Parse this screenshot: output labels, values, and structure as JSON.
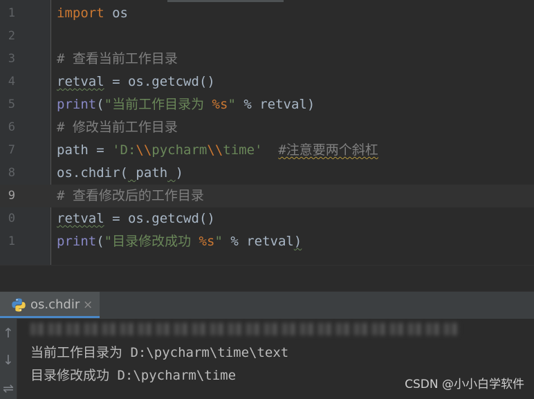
{
  "editor": {
    "line_numbers": [
      "1",
      "2",
      "3",
      "4",
      "5",
      "6",
      "7",
      "8",
      "9",
      "0",
      "1"
    ],
    "current_line_index": 8,
    "lines": [
      {
        "tokens": [
          {
            "t": "import",
            "c": "kw"
          },
          {
            "t": " os",
            "c": "op"
          }
        ]
      },
      {
        "tokens": []
      },
      {
        "tokens": [
          {
            "t": "# 查看当前工作目录",
            "c": "cm"
          }
        ]
      },
      {
        "tokens": [
          {
            "t": "retval",
            "c": "op",
            "sq": "g"
          },
          {
            "t": " = os.getcwd()",
            "c": "op"
          }
        ]
      },
      {
        "tokens": [
          {
            "t": "print",
            "c": "bi"
          },
          {
            "t": "(",
            "c": "op"
          },
          {
            "t": "\"当前工作目录为 ",
            "c": "str"
          },
          {
            "t": "%s",
            "c": "fmt"
          },
          {
            "t": "\"",
            "c": "str"
          },
          {
            "t": " % retval)",
            "c": "op"
          }
        ]
      },
      {
        "tokens": [
          {
            "t": "# 修改当前工作目录",
            "c": "cm"
          }
        ]
      },
      {
        "tokens": [
          {
            "t": "path = ",
            "c": "op"
          },
          {
            "t": "'D:",
            "c": "str"
          },
          {
            "t": "\\\\",
            "c": "esc"
          },
          {
            "t": "pycharm",
            "c": "str"
          },
          {
            "t": "\\\\",
            "c": "esc"
          },
          {
            "t": "time'",
            "c": "str"
          },
          {
            "t": "  ",
            "c": "op"
          },
          {
            "t": "#注意要两个斜杠",
            "c": "cm",
            "sq": "y"
          }
        ]
      },
      {
        "tokens": [
          {
            "t": "os.chdir(",
            "c": "op"
          },
          {
            "t": " ",
            "c": "op",
            "sq": "g"
          },
          {
            "t": "path",
            "c": "op"
          },
          {
            "t": " ",
            "c": "op",
            "sq": "g"
          },
          {
            "t": ")",
            "c": "op"
          }
        ]
      },
      {
        "tokens": [
          {
            "t": "# 查看修改后的工作目录",
            "c": "cm"
          }
        ]
      },
      {
        "tokens": [
          {
            "t": "retval",
            "c": "op",
            "sq": "g"
          },
          {
            "t": " = os.getcwd()",
            "c": "op"
          }
        ]
      },
      {
        "tokens": [
          {
            "t": "print",
            "c": "bi"
          },
          {
            "t": "(",
            "c": "op"
          },
          {
            "t": "\"目录修改成功 ",
            "c": "str"
          },
          {
            "t": "%s",
            "c": "fmt"
          },
          {
            "t": "\"",
            "c": "str"
          },
          {
            "t": " % retval",
            "c": "op"
          },
          {
            "t": ")",
            "c": "op",
            "sq": "g"
          }
        ]
      }
    ]
  },
  "run_panel": {
    "tab_label": "os.chdir",
    "tab_close": "×",
    "tool_up": "↑",
    "tool_down": "↓",
    "tool_wrap": "⇌",
    "output": [
      "当前工作目录为 D:\\pycharm\\time\\text",
      "目录修改成功 D:\\pycharm\\time"
    ]
  },
  "watermark": "CSDN @小小白学软件"
}
